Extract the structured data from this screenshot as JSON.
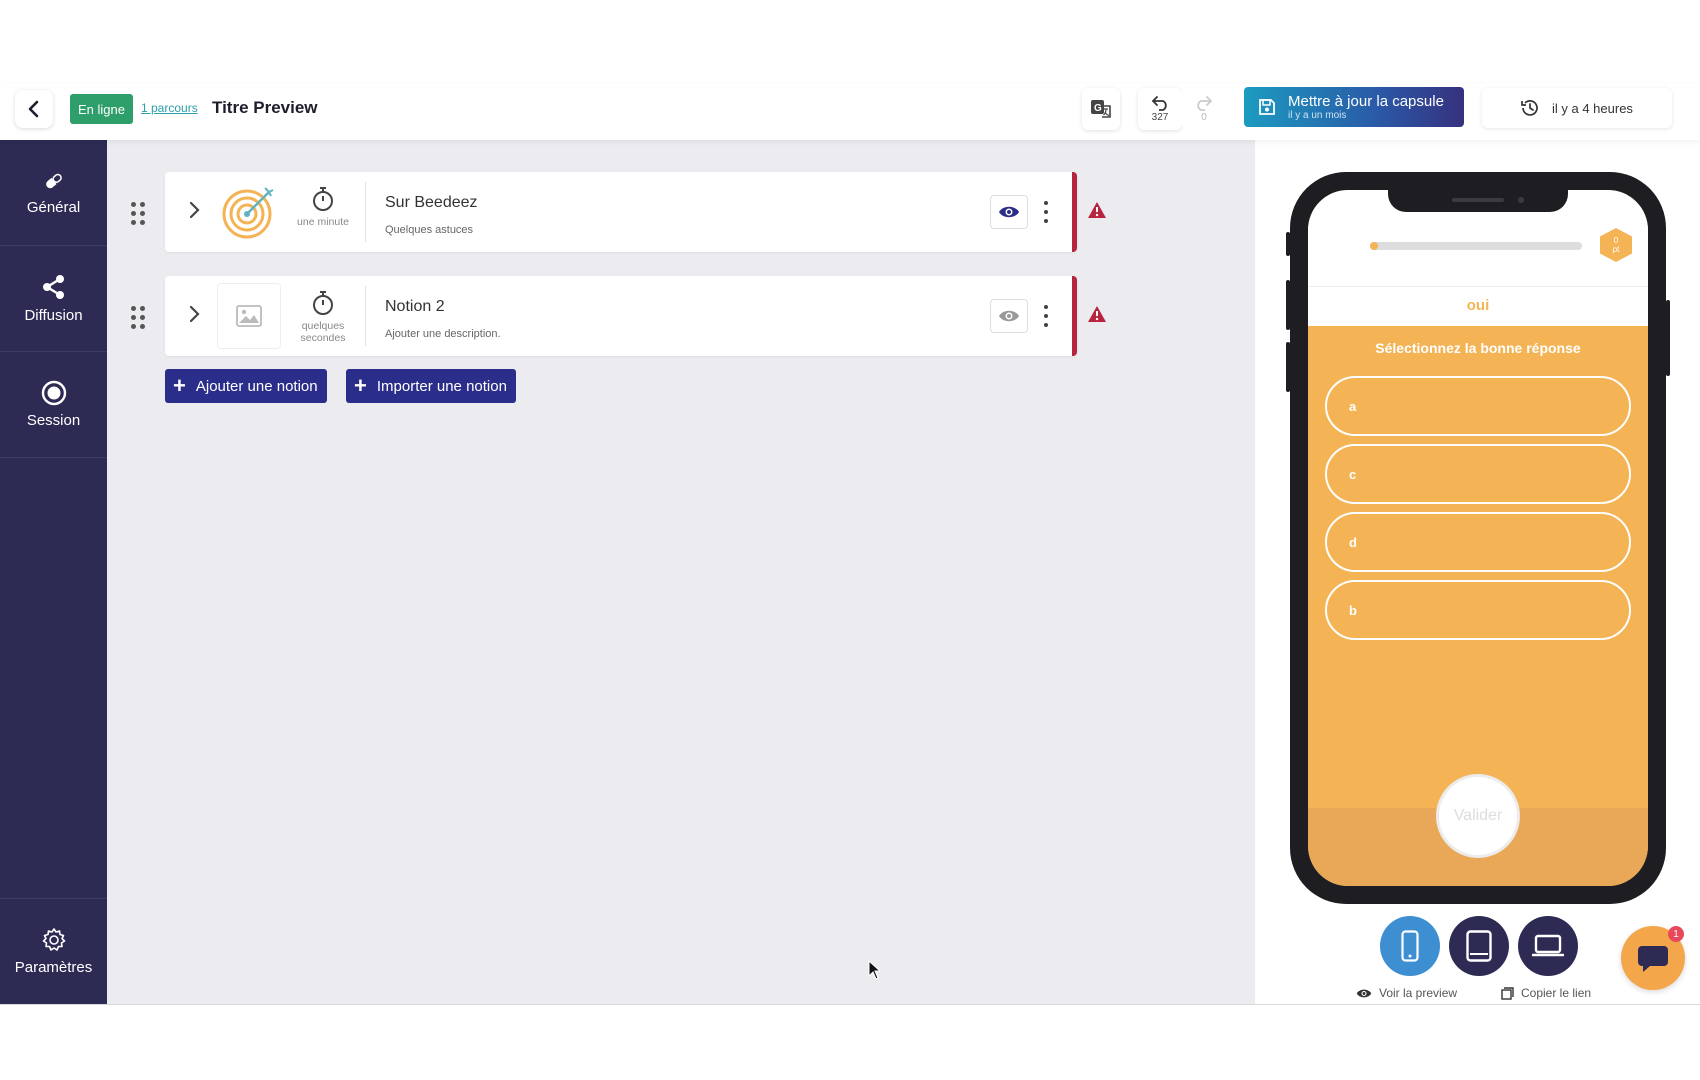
{
  "topbar": {
    "status_badge": "En ligne",
    "parcours_link": "1 parcours",
    "title": "Titre Preview",
    "undo_count": "327",
    "redo_count": "0",
    "update_button": {
      "label": "Mettre à jour la capsule",
      "sublabel": "il y a un mois"
    },
    "history_label": "il y a 4 heures"
  },
  "sidebar": {
    "items": [
      {
        "label": "Général",
        "icon": "pill-icon"
      },
      {
        "label": "Diffusion",
        "icon": "share-icon"
      },
      {
        "label": "Session",
        "icon": "record-icon"
      }
    ],
    "bottom_item": {
      "label": "Paramètres",
      "icon": "gear-icon"
    }
  },
  "notions": [
    {
      "title": "Sur Beedeez",
      "description": "Quelques astuces",
      "duration": "une minute",
      "thumbnail": "target-icon",
      "visible": true,
      "warning": true
    },
    {
      "title": "Notion 2",
      "description": "Ajouter une description.",
      "duration": "quelques secondes",
      "thumbnail": "image-placeholder-icon",
      "visible": false,
      "warning": true
    }
  ],
  "actions": {
    "add_notion": "Ajouter une notion",
    "import_notion": "Importer une notion"
  },
  "preview": {
    "points": "0",
    "points_unit": "pt",
    "progress": 0.04,
    "question_title": "oui",
    "instruction": "Sélectionnez la bonne réponse",
    "answers": [
      "a",
      "c",
      "d",
      "b"
    ],
    "validate_label": "Valider",
    "devices": [
      "mobile-icon",
      "tablet-icon",
      "laptop-icon"
    ],
    "active_device": "mobile-icon",
    "see_preview": "Voir la preview",
    "copy_link": "Copier le lien"
  },
  "chat": {
    "unread": "1"
  },
  "colors": {
    "sidebar": "#2d2a54",
    "primary": "#2b2d8a",
    "online": "#2e9e6a",
    "warning": "#b8243e",
    "quiz": "#f4b355"
  }
}
